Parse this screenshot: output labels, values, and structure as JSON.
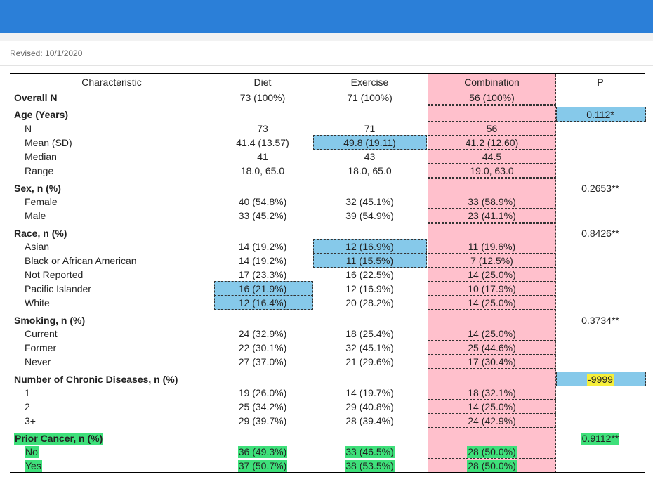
{
  "revised": "Revised: 10/1/2020",
  "headers": [
    "Characteristic",
    "Diet",
    "Exercise",
    "Combination",
    "P"
  ],
  "rows": [
    {
      "label": "Overall N",
      "diet": "73 (100%)",
      "exercise": "71 (100%)",
      "combination": "56 (100%)",
      "p": ""
    },
    {
      "label": "Age (Years)",
      "diet": "",
      "exercise": "",
      "combination": "",
      "p": "0.112*"
    },
    {
      "label": "N",
      "diet": "73",
      "exercise": "71",
      "combination": "56",
      "p": ""
    },
    {
      "label": "Mean (SD)",
      "diet": "41.4 (13.57)",
      "exercise": "49.8 (19.11)",
      "combination": "41.2 (12.60)",
      "p": ""
    },
    {
      "label": "Median",
      "diet": "41",
      "exercise": "43",
      "combination": "44.5",
      "p": ""
    },
    {
      "label": "Range",
      "diet": "18.0, 65.0",
      "exercise": "18.0, 65.0",
      "combination": "19.0, 63.0",
      "p": ""
    },
    {
      "label": "Sex, n (%)",
      "diet": "",
      "exercise": "",
      "combination": "",
      "p": "0.2653**"
    },
    {
      "label": "Female",
      "diet": "40 (54.8%)",
      "exercise": "32 (45.1%)",
      "combination": "33 (58.9%)",
      "p": ""
    },
    {
      "label": "Male",
      "diet": "33 (45.2%)",
      "exercise": "39 (54.9%)",
      "combination": "23 (41.1%)",
      "p": ""
    },
    {
      "label": "Race, n (%)",
      "diet": "",
      "exercise": "",
      "combination": "",
      "p": "0.8426**"
    },
    {
      "label": "Asian",
      "diet": "14 (19.2%)",
      "exercise": "12 (16.9%)",
      "combination": "11 (19.6%)",
      "p": ""
    },
    {
      "label": "Black or African American",
      "diet": "14 (19.2%)",
      "exercise": "11 (15.5%)",
      "combination": "7 (12.5%)",
      "p": ""
    },
    {
      "label": "Not Reported",
      "diet": "17 (23.3%)",
      "exercise": "16 (22.5%)",
      "combination": "14 (25.0%)",
      "p": ""
    },
    {
      "label": "Pacific Islander",
      "diet": "16 (21.9%)",
      "exercise": "12 (16.9%)",
      "combination": "10 (17.9%)",
      "p": ""
    },
    {
      "label": "White",
      "diet": "12 (16.4%)",
      "exercise": "20 (28.2%)",
      "combination": "14 (25.0%)",
      "p": ""
    },
    {
      "label": "Smoking, n (%)",
      "diet": "",
      "exercise": "",
      "combination": "",
      "p": "0.3734**"
    },
    {
      "label": "Current",
      "diet": "24 (32.9%)",
      "exercise": "18 (25.4%)",
      "combination": "14 (25.0%)",
      "p": ""
    },
    {
      "label": "Former",
      "diet": "22 (30.1%)",
      "exercise": "32 (45.1%)",
      "combination": "25 (44.6%)",
      "p": ""
    },
    {
      "label": "Never",
      "diet": "27 (37.0%)",
      "exercise": "21 (29.6%)",
      "combination": "17 (30.4%)",
      "p": ""
    },
    {
      "label": "Number of Chronic Diseases, n (%)",
      "diet": "",
      "exercise": "",
      "combination": "",
      "p": "-9999"
    },
    {
      "label": "1",
      "diet": "19 (26.0%)",
      "exercise": "14 (19.7%)",
      "combination": "18 (32.1%)",
      "p": ""
    },
    {
      "label": "2",
      "diet": "25 (34.2%)",
      "exercise": "29 (40.8%)",
      "combination": "14 (25.0%)",
      "p": ""
    },
    {
      "label": "3+",
      "diet": "29 (39.7%)",
      "exercise": "28 (39.4%)",
      "combination": "24 (42.9%)",
      "p": ""
    },
    {
      "label": "Prior Cancer, n (%)",
      "diet": "",
      "exercise": "",
      "combination": "",
      "p": "0.9112**"
    },
    {
      "label": "No",
      "diet": "36 (49.3%)",
      "exercise": "33 (46.5%)",
      "combination": "28 (50.0%)",
      "p": ""
    },
    {
      "label": "Yes",
      "diet": "37 (50.7%)",
      "exercise": "38 (53.5%)",
      "combination": "28 (50.0%)",
      "p": ""
    }
  ],
  "colors": {
    "topbar": "#2b7fd8",
    "pink": "#ffc0cc",
    "blue": "#86c9ea",
    "green": "#3ee07a",
    "yellow": "#f6ef3a"
  }
}
